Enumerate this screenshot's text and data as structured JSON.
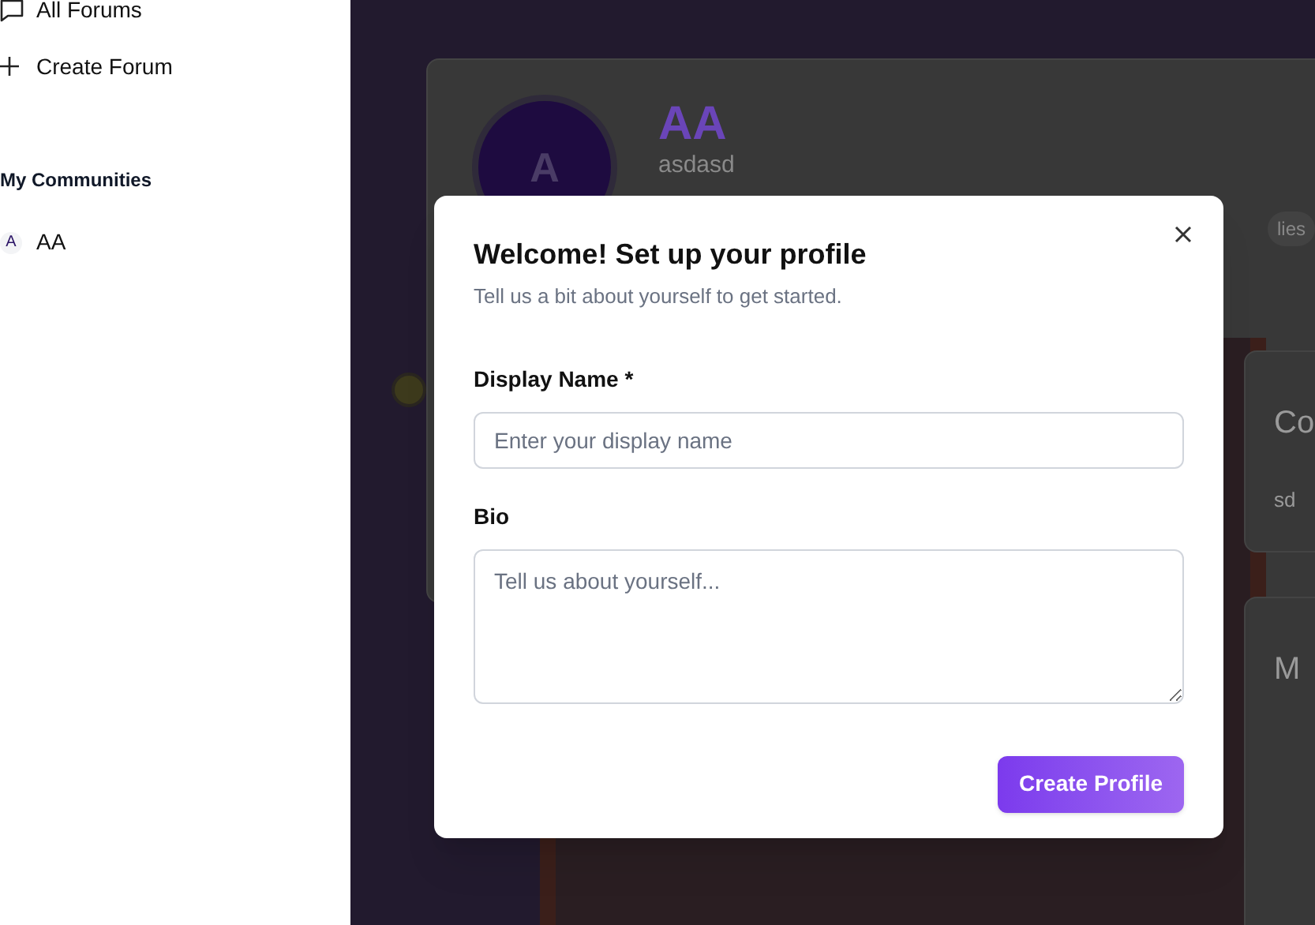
{
  "sidebar": {
    "items": [
      {
        "kind": "forums",
        "label": "All Forums"
      },
      {
        "kind": "create",
        "label": "Create Forum"
      }
    ],
    "section_title": "My Communities",
    "communities": [
      {
        "avatar": "A",
        "name": "AA"
      }
    ]
  },
  "community": {
    "avatar": "A",
    "name": "AA",
    "description": "asdasd",
    "badge": "lies"
  },
  "side_cards": [
    {
      "title": "Co",
      "text": "sd"
    },
    {
      "title": "M"
    }
  ],
  "dialog": {
    "title": "Welcome! Set up your profile",
    "subtitle": "Tell us a bit about yourself to get started.",
    "fields": [
      {
        "kind": "input",
        "label": "Display Name *",
        "placeholder": "Enter your display name"
      },
      {
        "kind": "textarea",
        "label": "Bio",
        "placeholder": "Tell us about yourself..."
      }
    ],
    "submit": "Create Profile"
  }
}
